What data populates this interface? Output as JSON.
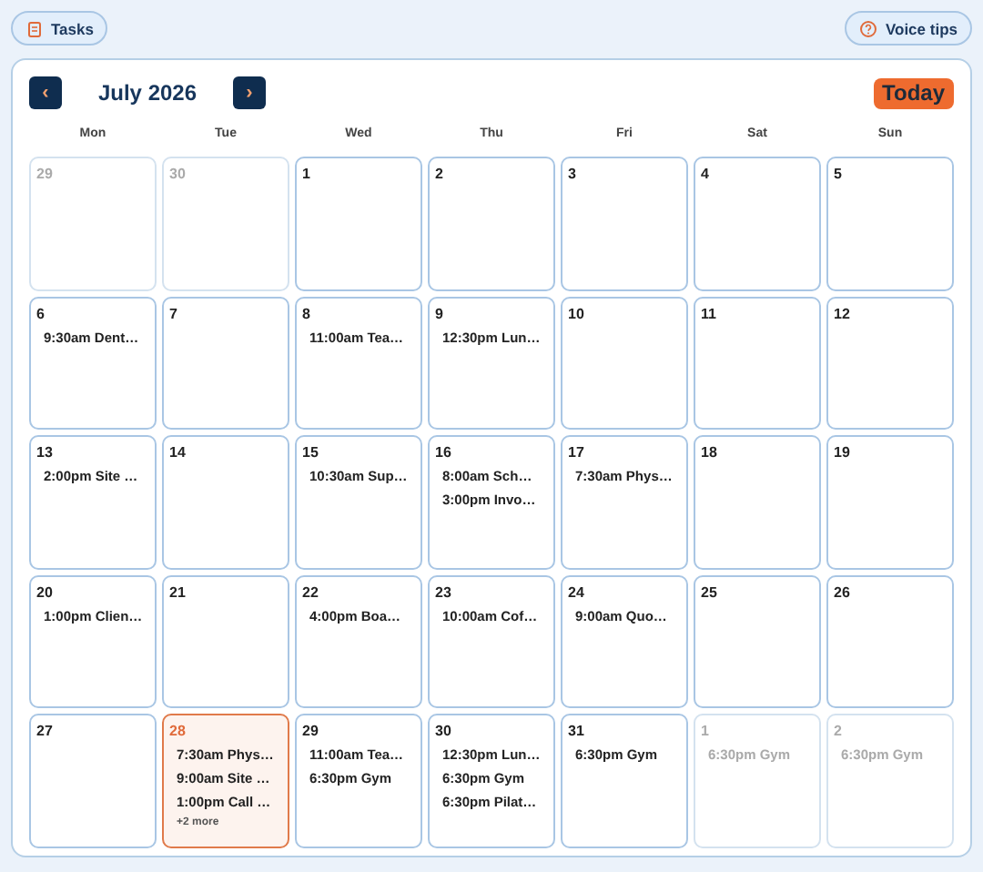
{
  "toolbar": {
    "tasks": "Tasks",
    "voice_tips": "Voice tips"
  },
  "calendar": {
    "prev": "‹",
    "next": "›",
    "title": "July 2026",
    "today_button": "Today",
    "weekdays": [
      "Mon",
      "Tue",
      "Wed",
      "Thu",
      "Fri",
      "Sat",
      "Sun"
    ],
    "days": [
      {
        "date": "29",
        "in_month": false,
        "today": false
      },
      {
        "date": "30",
        "in_month": false,
        "today": false
      },
      {
        "date": "1",
        "in_month": true,
        "today": false
      },
      {
        "date": "2",
        "in_month": true,
        "today": false
      },
      {
        "date": "3",
        "in_month": true,
        "today": false
      },
      {
        "date": "4",
        "in_month": true,
        "today": false
      },
      {
        "date": "5",
        "in_month": true,
        "today": false
      },
      {
        "date": "6",
        "in_month": true,
        "today": false,
        "events": [
          "9:30am Dent…"
        ]
      },
      {
        "date": "7",
        "in_month": true,
        "today": false
      },
      {
        "date": "8",
        "in_month": true,
        "today": false,
        "events": [
          "11:00am Tea…"
        ]
      },
      {
        "date": "9",
        "in_month": true,
        "today": false,
        "events": [
          "12:30pm Lun…"
        ]
      },
      {
        "date": "10",
        "in_month": true,
        "today": false
      },
      {
        "date": "11",
        "in_month": true,
        "today": false
      },
      {
        "date": "12",
        "in_month": true,
        "today": false
      },
      {
        "date": "13",
        "in_month": true,
        "today": false,
        "events": [
          "2:00pm Site …"
        ]
      },
      {
        "date": "14",
        "in_month": true,
        "today": false
      },
      {
        "date": "15",
        "in_month": true,
        "today": false,
        "events": [
          "10:30am Sup…"
        ]
      },
      {
        "date": "16",
        "in_month": true,
        "today": false,
        "events": [
          "8:00am Sch…",
          "3:00pm Invo…"
        ]
      },
      {
        "date": "17",
        "in_month": true,
        "today": false,
        "events": [
          "7:30am Phys…"
        ]
      },
      {
        "date": "18",
        "in_month": true,
        "today": false
      },
      {
        "date": "19",
        "in_month": true,
        "today": false
      },
      {
        "date": "20",
        "in_month": true,
        "today": false,
        "events": [
          "1:00pm Clien…"
        ]
      },
      {
        "date": "21",
        "in_month": true,
        "today": false
      },
      {
        "date": "22",
        "in_month": true,
        "today": false,
        "events": [
          "4:00pm Boa…"
        ]
      },
      {
        "date": "23",
        "in_month": true,
        "today": false,
        "events": [
          "10:00am Cof…"
        ]
      },
      {
        "date": "24",
        "in_month": true,
        "today": false,
        "events": [
          "9:00am Quo…"
        ]
      },
      {
        "date": "25",
        "in_month": true,
        "today": false
      },
      {
        "date": "26",
        "in_month": true,
        "today": false
      },
      {
        "date": "27",
        "in_month": true,
        "today": false
      },
      {
        "date": "28",
        "in_month": true,
        "today": true,
        "events": [
          "7:30am Phys…",
          "9:00am Site …",
          "1:00pm Call …"
        ],
        "more": "+2 more"
      },
      {
        "date": "29",
        "in_month": true,
        "today": false,
        "events": [
          "11:00am Tea…",
          "6:30pm Gym"
        ]
      },
      {
        "date": "30",
        "in_month": true,
        "today": false,
        "events": [
          "12:30pm Lun…",
          "6:30pm Gym",
          "6:30pm Pilat…"
        ]
      },
      {
        "date": "31",
        "in_month": true,
        "today": false,
        "events": [
          "6:30pm Gym"
        ]
      },
      {
        "date": "1",
        "in_month": false,
        "today": false,
        "events": [
          "6:30pm Gym"
        ]
      },
      {
        "date": "2",
        "in_month": false,
        "today": false,
        "events": [
          "6:30pm Gym"
        ]
      }
    ]
  }
}
